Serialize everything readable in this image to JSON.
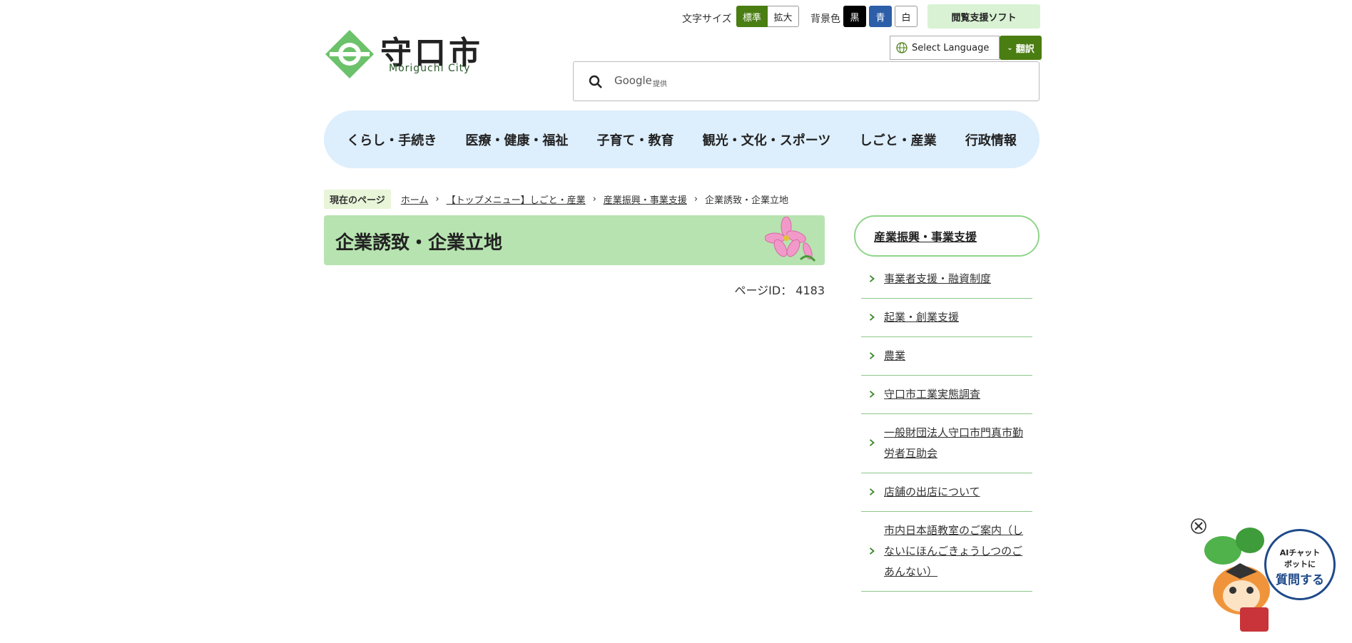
{
  "header": {
    "logo_title": "守口市",
    "logo_subtitle": "Moriguchi City",
    "font_size_label": "文字サイズ",
    "font_standard": "標準",
    "font_large": "拡大",
    "bg_label": "背景色",
    "bg_black": "黒",
    "bg_blue": "青",
    "bg_white": "白",
    "browse_support": "閲覧支援ソフト",
    "select_language": "Select Language",
    "translate": "翻訳",
    "search_placeholder": "Google",
    "search_provided": "提供"
  },
  "nav": {
    "items": [
      "くらし・手続き",
      "医療・健康・福祉",
      "子育て・教育",
      "観光・文化・スポーツ",
      "しごと・産業",
      "行政情報"
    ]
  },
  "breadcrumb": {
    "current_label": "現在のページ",
    "items": [
      "ホーム",
      "【トップメニュー】しごと・産業",
      "産業振興・事業支援",
      "企業誘致・企業立地"
    ]
  },
  "main": {
    "title": "企業誘致・企業立地",
    "page_id": "ページID： 4183"
  },
  "sidebar": {
    "heading": "産業振興・事業支援",
    "items": [
      "事業者支援・融資制度",
      "起業・創業支援",
      "農業",
      "守口市工業実態調査",
      "一般財団法人守口市門真市勤労者互助会",
      "店舗の出店について",
      "市内日本語教室のご案内（しないにほんごきょうしつのごあんない）"
    ]
  },
  "chatbot": {
    "line1": "AIチャット",
    "line2": "ボットに",
    "line3": "質問する"
  },
  "colors": {
    "brand_green": "#4a7d12",
    "nav_bg": "#ddeefc",
    "title_bg": "#b7e3b0",
    "blue_btn": "#2d5fa8"
  }
}
